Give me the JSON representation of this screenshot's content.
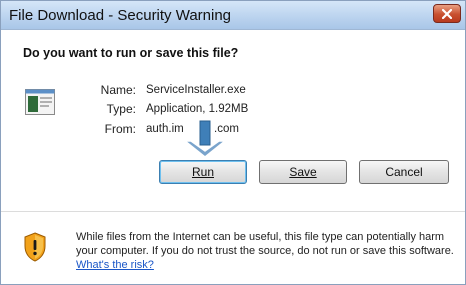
{
  "window": {
    "title": "File Download - Security Warning"
  },
  "header": {
    "question": "Do you want to run or save this file?"
  },
  "file": {
    "icon": "installer-file-icon",
    "name_label": "Name:",
    "name_value": "ServiceInstaller.exe",
    "type_label": "Type:",
    "type_value": "Application, 1.92MB",
    "from_label": "From:",
    "from_value_start": "auth.im",
    "from_value_end": ".com"
  },
  "buttons": {
    "run_label": "Run",
    "save_label": "Save",
    "cancel_label": "Cancel"
  },
  "warning": {
    "icon": "security-shield-icon",
    "text": "While files from the Internet can be useful, this file type can potentially harm your computer. If you do not trust the source, do not run or save this software.",
    "link_text": "What's the risk?"
  },
  "colors": {
    "titlebar": "#bcd4ef",
    "close_button": "#c8502f",
    "link": "#1a56c7",
    "arrow": "#3f7fb8"
  }
}
